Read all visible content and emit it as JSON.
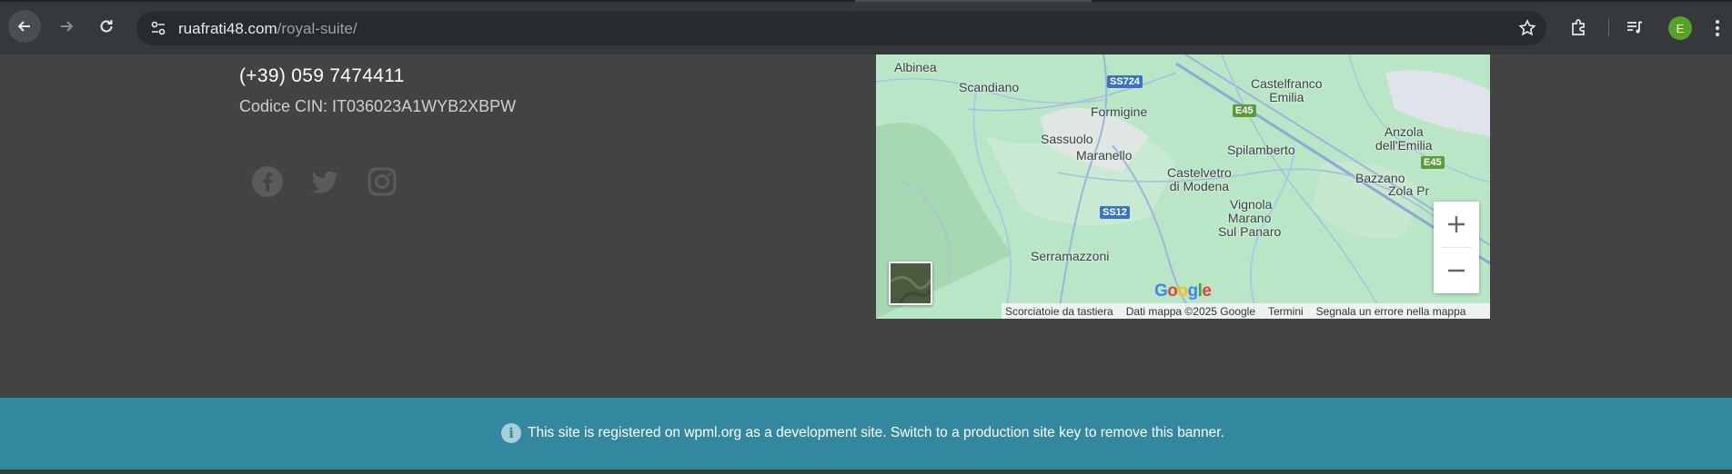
{
  "browser": {
    "url_domain": "ruafrati48.com",
    "url_path": "/royal-suite/",
    "profile_initial": "E",
    "icons": [
      "back-arrow-icon",
      "forward-arrow-icon",
      "reload-icon",
      "site-settings-icon",
      "bookmark-star-icon",
      "extensions-puzzle-icon",
      "media-control-icon",
      "kebab-menu-icon"
    ]
  },
  "contact": {
    "phone": "(+39) 059 7474411",
    "cin": "Codice CIN: IT036023A1WYB2XBPW",
    "social": [
      "facebook-icon",
      "twitter-icon",
      "instagram-icon"
    ]
  },
  "map": {
    "places": {
      "albinea": "Albinea",
      "scandiano": "Scandiano",
      "castelfranco": "Castelfranco\nEmilia",
      "formigine": "Formigine",
      "sassuolo": "Sassuolo",
      "maranello": "Maranello",
      "spilamberto": "Spilamberto",
      "anzola": "Anzola\ndell'Emilia",
      "castelvetro": "Castelvetro\ndi Modena",
      "bazzano": "Bazzano",
      "zola": "Zola Pr",
      "vignola": "Vignola",
      "marano": "Marano\nSul Panaro",
      "serramazzoni": "Serramazzoni"
    },
    "roads": {
      "ss724": "SS724",
      "e45a": "E45",
      "e45b": "E45",
      "ss12": "SS12"
    },
    "attribution": {
      "shortcuts": "Scorciatoie da tastiera",
      "data": "Dati mappa ©2025 Google",
      "terms": "Termini",
      "report": "Segnala un errore nella mappa"
    },
    "colors": {
      "land": "#b9e6c7",
      "road": "#8fa7d6",
      "water": "#9fc8f0"
    }
  },
  "banner": {
    "text": "This site is registered on wpml.org as a development site. Switch to a production site key to remove this banner.",
    "color": "#33889f"
  }
}
